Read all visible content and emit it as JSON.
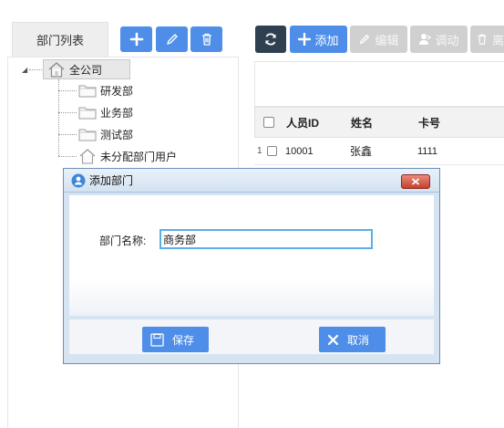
{
  "sidebar": {
    "tab_label": "部门列表",
    "tree": {
      "root": "全公司",
      "children": [
        "研发部",
        "业务部",
        "测试部",
        "未分配部门用户"
      ]
    }
  },
  "toolbar": {
    "add_label": "添加",
    "edit_label": "编辑",
    "transfer_label": "调动",
    "leave_label": "离"
  },
  "grid": {
    "columns": [
      "人员ID",
      "姓名",
      "卡号"
    ],
    "rows": [
      {
        "index": "1",
        "id": "10001",
        "name": "张鑫",
        "card": "1111"
      }
    ]
  },
  "dialog": {
    "title": "添加部门",
    "field_label": "部门名称:",
    "field_value": "商务部",
    "save_label": "保存",
    "cancel_label": "取消"
  },
  "colors": {
    "accent": "#4f8ee8",
    "dark_button": "#2f4050",
    "disabled_button": "#d0d0d0",
    "close_button": "#c3412e"
  }
}
